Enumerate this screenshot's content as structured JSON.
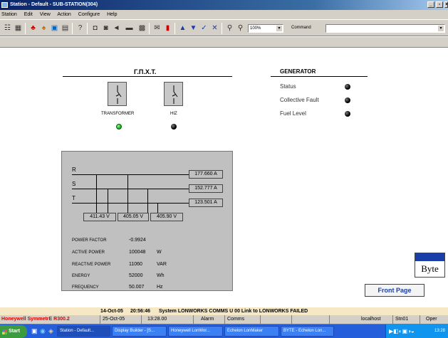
{
  "window": {
    "title": "Station - Default - SUB-STATION(304)",
    "minimize": "_",
    "maximize": "×"
  },
  "menu": [
    "Station",
    "Edit",
    "View",
    "Action",
    "Configure",
    "Help"
  ],
  "toolbar": {
    "zoom": "100%",
    "command_label": "Command",
    "command_value": ""
  },
  "display": {
    "substation_title": "Γ.Π.Χ.Τ.",
    "switches": [
      {
        "label": "TRANSFORMER",
        "status_color": "#33cc33"
      },
      {
        "label": "HIZ",
        "status_color": "#000000"
      }
    ],
    "generator": {
      "title": "GENERATOR",
      "rows": [
        "Status",
        "Collective Fault",
        "Fuel Level"
      ]
    },
    "meter": {
      "phases": [
        "R",
        "S",
        "T"
      ],
      "currents": [
        "177.660  A",
        "152.777  A",
        "123.501  A"
      ],
      "voltages": [
        "411.43  V",
        "405.05  V",
        "405.90  V"
      ],
      "readings": [
        {
          "label": "POWER FACTOR",
          "value": "-0.9924",
          "unit": ""
        },
        {
          "label": "ACTIVE POWER",
          "value": "100048",
          "unit": "W"
        },
        {
          "label": "REACTIVE POWER",
          "value": "11060",
          "unit": "VAR"
        },
        {
          "label": "ENERGY",
          "value": "52000",
          "unit": "Wh"
        },
        {
          "label": "FREQUENCY",
          "value": "50.007",
          "unit": "Hz"
        }
      ]
    },
    "logo_text": "Byte",
    "front_page_button": "Front Page"
  },
  "alarm_line": {
    "date": "14-Oct-05",
    "time": "20:56:46",
    "message": "System  LONWORKS  COMMS  U 00 Link to LONWORKS  FAILED"
  },
  "statusbar": {
    "product": "Honeywell SymmetrE R300.2",
    "date": "25-Oct-05",
    "time": "13:28.00",
    "alarm": "Alarm",
    "comms": "Comms",
    "host": "localhost",
    "station": "Stn01",
    "mode": "Oper"
  },
  "taskbar": {
    "start": "Start",
    "tasks": [
      "Station - Default...",
      "Display Builder - [S...",
      "Honeywell LonWor...",
      "Echelon LonMaker",
      "BYTE - Echelon Lon..."
    ],
    "clock": "13:28"
  }
}
